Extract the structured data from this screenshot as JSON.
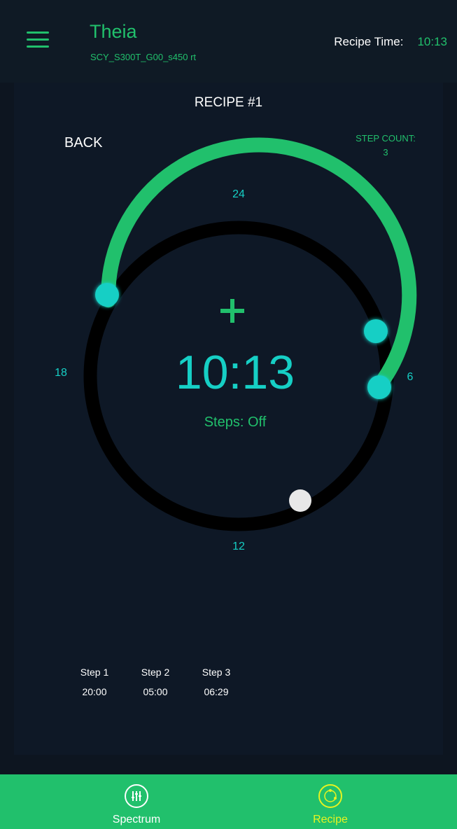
{
  "header": {
    "title": "Theia",
    "subtitle": "SCY_S300T_G00_s450 rt",
    "recipe_time_label": "Recipe Time:",
    "recipe_time_value": "10:13"
  },
  "main": {
    "recipe_title": "RECIPE #1",
    "back_label": "BACK",
    "step_count_label": "STEP COUNT:",
    "step_count_value": "3"
  },
  "dial": {
    "labels": {
      "top": "24",
      "right": "6",
      "bottom": "12",
      "left": "18"
    },
    "add_symbol": "+",
    "time": "10:13",
    "steps_text": "Steps: Off"
  },
  "steps": [
    {
      "label": "Step 1",
      "time": "20:00"
    },
    {
      "label": "Step 2",
      "time": "05:00"
    },
    {
      "label": "Step 3",
      "time": "06:29"
    }
  ],
  "nav": {
    "spectrum_label": "Spectrum",
    "recipe_label": "Recipe"
  },
  "icons": {
    "menu": "hamburger-menu-icon",
    "spectrum": "sliders-icon",
    "recipe": "circular-dial-icon"
  },
  "colors": {
    "accent_green": "#21c06c",
    "teal": "#16cfc5",
    "background": "#0d1520",
    "active_nav": "#e7f321"
  }
}
